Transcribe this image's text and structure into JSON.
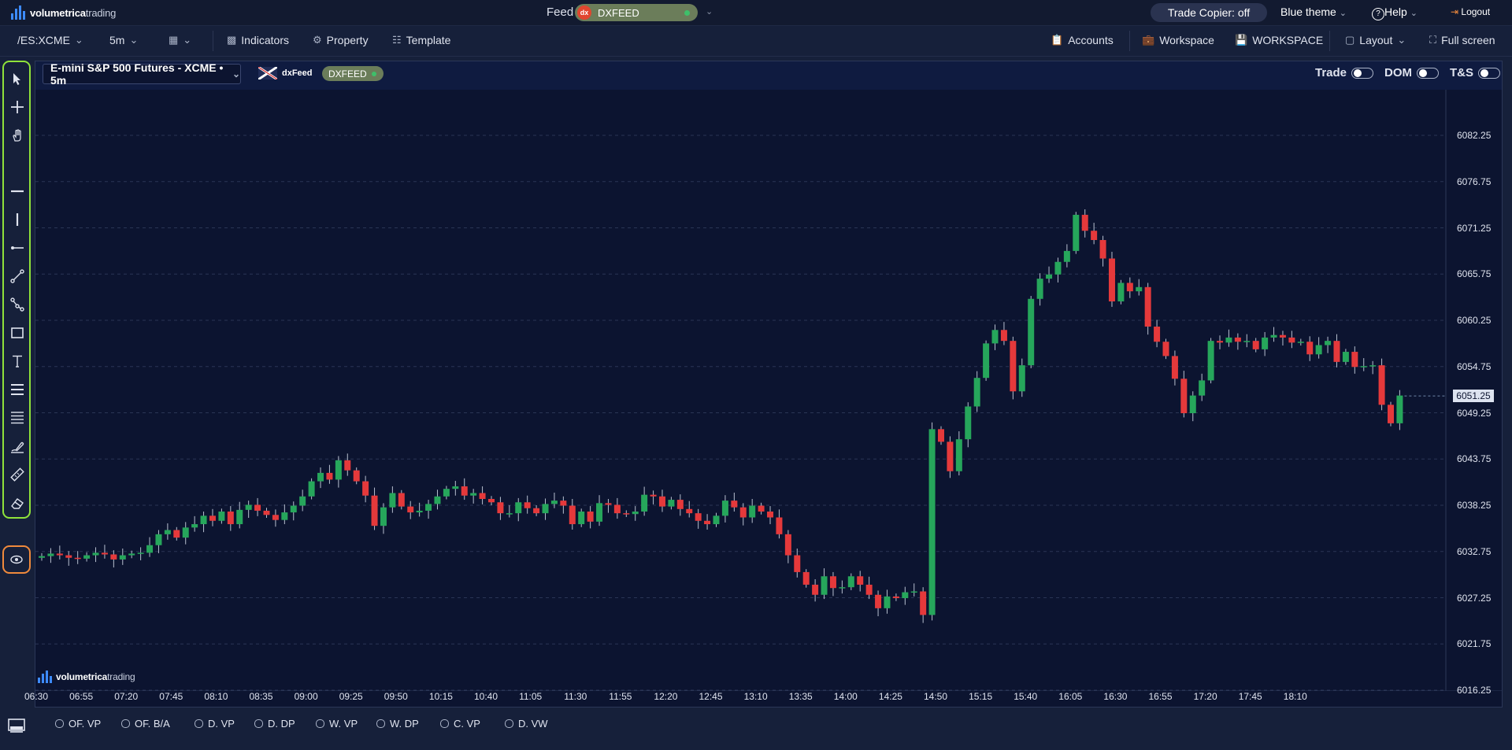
{
  "app": {
    "logo_bold": "volumetrica",
    "logo_light": "trading"
  },
  "topbar": {
    "feed_label": "Feed",
    "feed_value": "DXFEED",
    "trade_copier": "Trade Copier: off",
    "theme": "Blue theme",
    "help": "Help",
    "logout": "Logout"
  },
  "toolbar": {
    "symbol": "/ES:XCME",
    "timeframe": "5m",
    "indicators": "Indicators",
    "property": "Property",
    "template": "Template",
    "accounts": "Accounts",
    "workspace": "Workspace",
    "workspace_name": "WORKSPACE",
    "layout": "Layout",
    "fullscreen": "Full screen"
  },
  "chart_header": {
    "instrument": "E-mini S&P 500 Futures - XCME • 5m",
    "provider": "dxFeed",
    "feed": "DXFEED",
    "toggles": [
      {
        "label": "Trade",
        "on": false
      },
      {
        "label": "DOM",
        "on": false
      },
      {
        "label": "T&S",
        "on": false
      }
    ]
  },
  "tools": [
    "cursor-icon",
    "crosshair-icon",
    "hand-icon",
    "horizontal-line-icon",
    "vertical-line-icon",
    "ray-icon",
    "trend-line-icon",
    "polyline-icon",
    "rectangle-icon",
    "text-icon",
    "fib-retracement-icon",
    "parallel-lines-icon",
    "brush-icon",
    "ruler-icon",
    "eraser-icon"
  ],
  "bottom_options": [
    "OF. VP",
    "OF. B/A",
    "D. VP",
    "D. DP",
    "W. VP",
    "W. DP",
    "C. VP",
    "D. VW"
  ],
  "colors": {
    "up": "#26a65b",
    "down": "#e5393b",
    "background": "#0c1430",
    "accent_frame_tools": "#8fe23a",
    "accent_frame_eye": "#f08a3c"
  },
  "chart_data": {
    "type": "candlestick",
    "title": "E-mini S&P 500 Futures - XCME • 5m",
    "last_price": "6051.25",
    "y_ticks": [
      "6082.25",
      "6076.75",
      "6071.25",
      "6065.75",
      "6060.25",
      "6054.75",
      "6049.25",
      "6043.75",
      "6038.25",
      "6032.75",
      "6027.25",
      "6021.75",
      "6016.25"
    ],
    "x_ticks": [
      "06:30",
      "06:55",
      "07:20",
      "07:45",
      "08:10",
      "08:35",
      "09:00",
      "09:25",
      "09:50",
      "10:15",
      "10:40",
      "11:05",
      "11:30",
      "11:55",
      "12:20",
      "12:45",
      "13:10",
      "13:35",
      "14:00",
      "14:25",
      "14:50",
      "15:15",
      "15:40",
      "16:05",
      "16:30",
      "16:55",
      "17:20",
      "17:45",
      "18:10"
    ],
    "ylim": [
      6016.25,
      6082.25
    ],
    "grid": true,
    "candles_close": [
      6032.2,
      6032.5,
      6032.3,
      6032.0,
      6031.9,
      6032.3,
      6032.6,
      6032.4,
      6031.8,
      6032.3,
      6032.5,
      6032.6,
      6033.5,
      6034.8,
      6035.3,
      6034.4,
      6035.6,
      6036.0,
      6037.0,
      6036.4,
      6037.5,
      6036.0,
      6037.7,
      6038.3,
      6037.6,
      6037.1,
      6036.5,
      6037.4,
      6038.2,
      6039.3,
      6041.1,
      6042.1,
      6041.3,
      6043.6,
      6042.4,
      6041.1,
      6039.4,
      6035.8,
      6038.0,
      6039.7,
      6038.1,
      6037.4,
      6037.6,
      6038.4,
      6039.3,
      6040.2,
      6040.5,
      6039.4,
      6039.7,
      6039.0,
      6038.6,
      6037.3,
      6037.3,
      6038.6,
      6037.9,
      6037.3,
      6038.4,
      6038.8,
      6038.2,
      6036.0,
      6037.5,
      6036.3,
      6038.5,
      6038.3,
      6037.3,
      6037.2,
      6037.5,
      6039.5,
      6039.3,
      6038.1,
      6038.9,
      6037.8,
      6037.3,
      6036.4,
      6036.0,
      6037.0,
      6038.8,
      6038.0,
      6036.8,
      6038.2,
      6037.5,
      6036.8,
      6034.8,
      6032.3,
      6030.3,
      6028.8,
      6027.6,
      6029.8,
      6028.4,
      6028.5,
      6029.8,
      6028.8,
      6027.6,
      6026.0,
      6027.4,
      6027.2,
      6027.9,
      6028.0,
      6025.2,
      6047.3,
      6045.8,
      6042.3,
      6046.1,
      6050.0,
      6053.4,
      6057.5,
      6059.1,
      6057.8,
      6051.8,
      6054.9,
      6062.8,
      6065.2,
      6065.7,
      6067.2,
      6068.5,
      6072.8,
      6070.9,
      6069.8,
      6067.6,
      6062.5,
      6064.7,
      6063.7,
      6064.2,
      6059.5,
      6057.7,
      6056.0,
      6053.3,
      6049.2,
      6051.3,
      6053.1,
      6057.8,
      6057.6,
      6058.2,
      6057.7,
      6057.8,
      6056.8,
      6058.2,
      6058.5,
      6058.2,
      6057.6,
      6057.7,
      6056.2,
      6057.3,
      6057.8,
      6055.3,
      6056.5,
      6054.7,
      6054.8,
      6054.9,
      6050.2,
      6048.0,
      6051.3
    ]
  }
}
